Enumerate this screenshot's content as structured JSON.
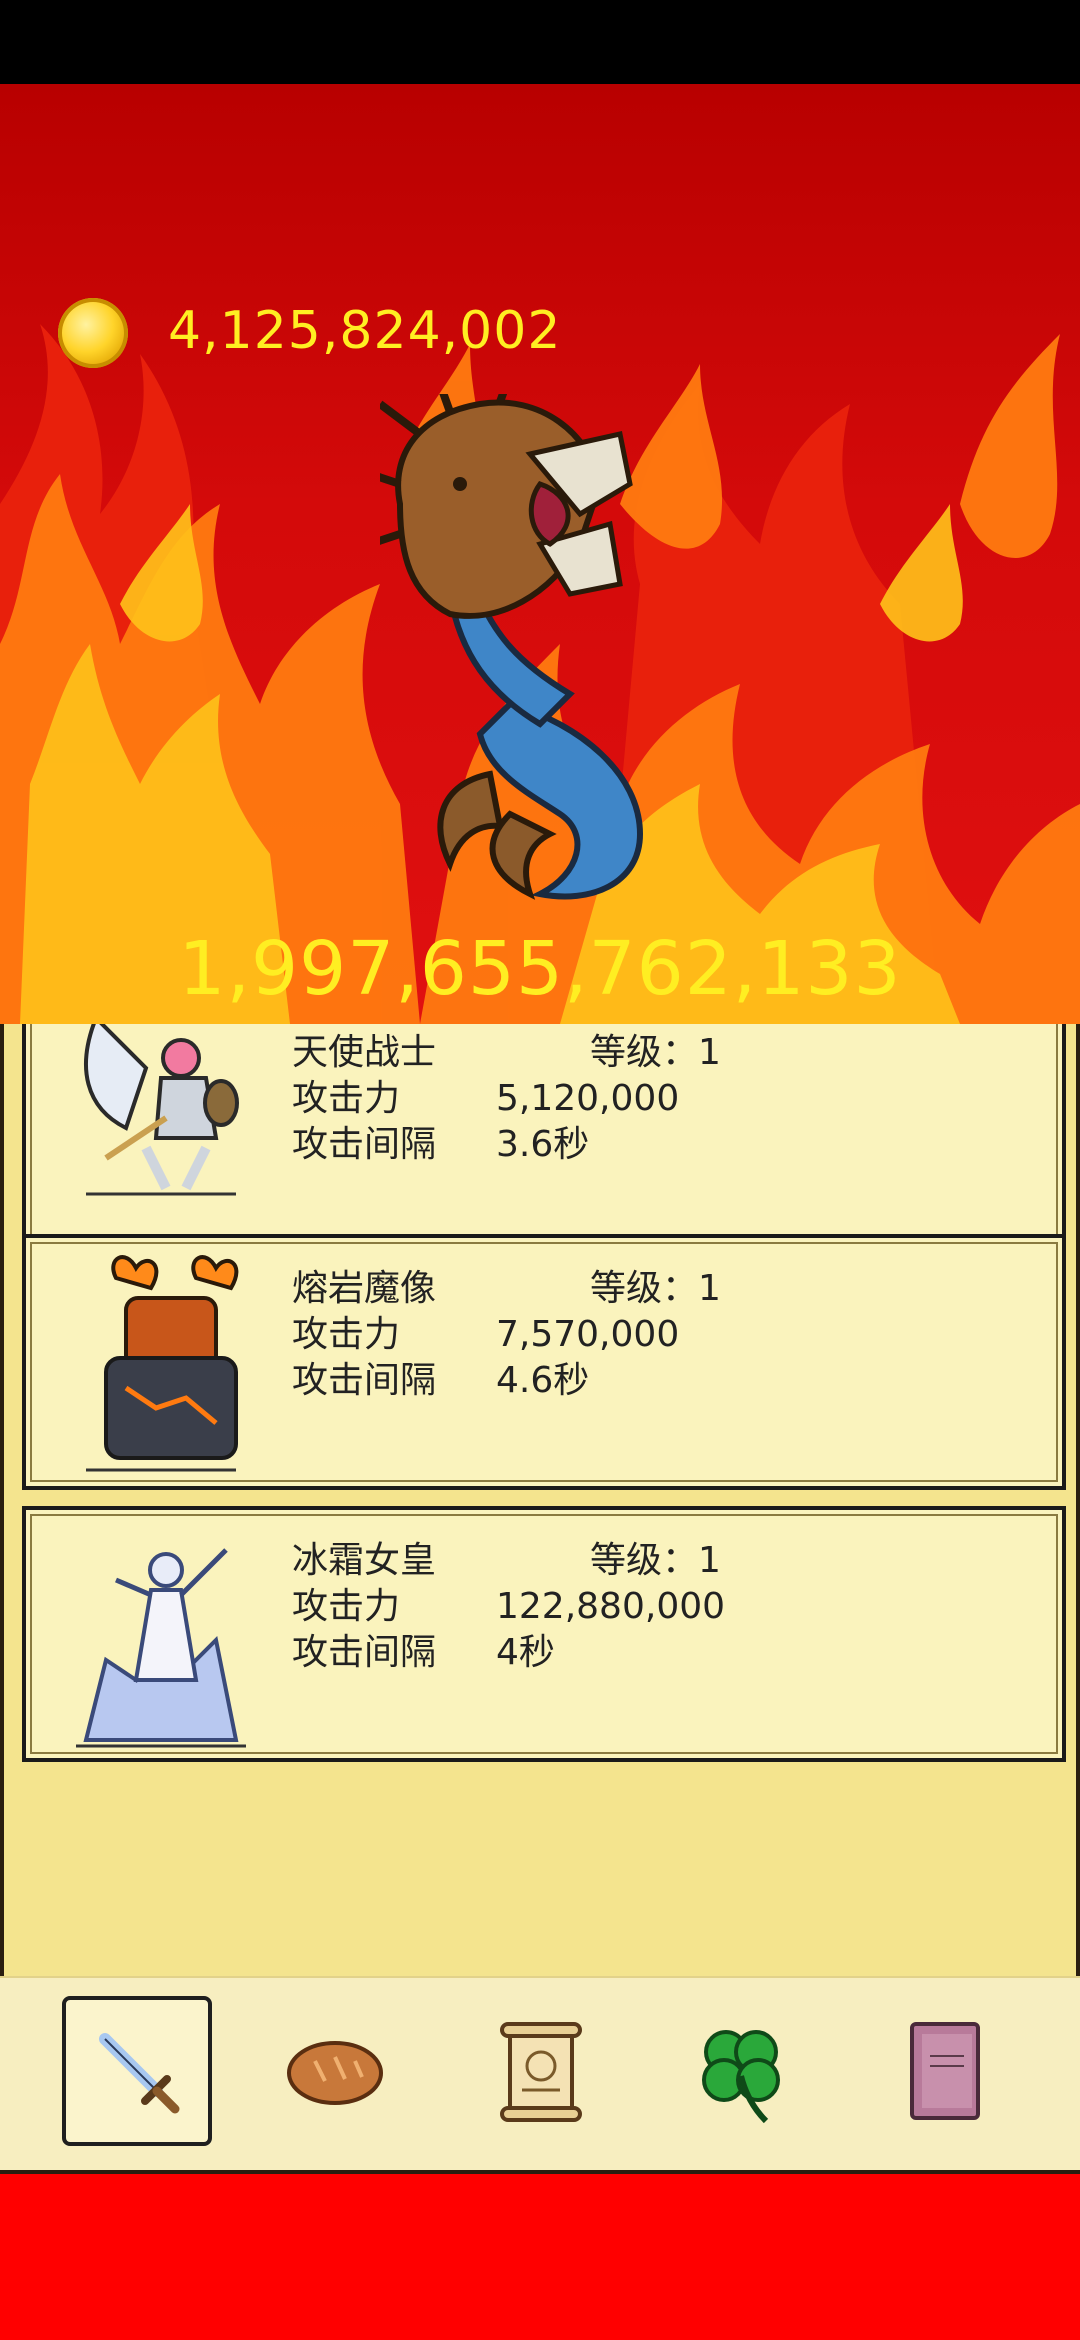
{
  "currency": {
    "icon": "gold-coin-icon",
    "amount": "4,125,824,002"
  },
  "boss": {
    "name_icon": "serpent-dragon-boss",
    "hp": "1,997,655,762,133"
  },
  "heroes": [
    {
      "name": "天使战士",
      "level_label": "等级：1",
      "attack_label": "攻击力",
      "attack": "5,120,000",
      "interval_label": "攻击间隔",
      "interval": "3.6秒"
    },
    {
      "name": "熔岩魔像",
      "level_label": "等级：1",
      "attack_label": "攻击力",
      "attack": "7,570,000",
      "interval_label": "攻击间隔",
      "interval": "4.6秒"
    },
    {
      "name": "冰霜女皇",
      "level_label": "等级：1",
      "attack_label": "攻击力",
      "attack": "122,880,000",
      "interval_label": "攻击间隔",
      "interval": "4秒"
    }
  ],
  "tabs": [
    {
      "icon": "sword-icon",
      "active": true
    },
    {
      "icon": "bread-icon",
      "active": false
    },
    {
      "icon": "scroll-icon",
      "active": false
    },
    {
      "icon": "clover-icon",
      "active": false
    },
    {
      "icon": "book-icon",
      "active": false
    }
  ],
  "colors": {
    "accent_text": "#ffee22",
    "panel": "#f4e48e",
    "card": "#faf3bd",
    "fire_red": "#d40a0a",
    "footer_red": "#ff0000"
  }
}
